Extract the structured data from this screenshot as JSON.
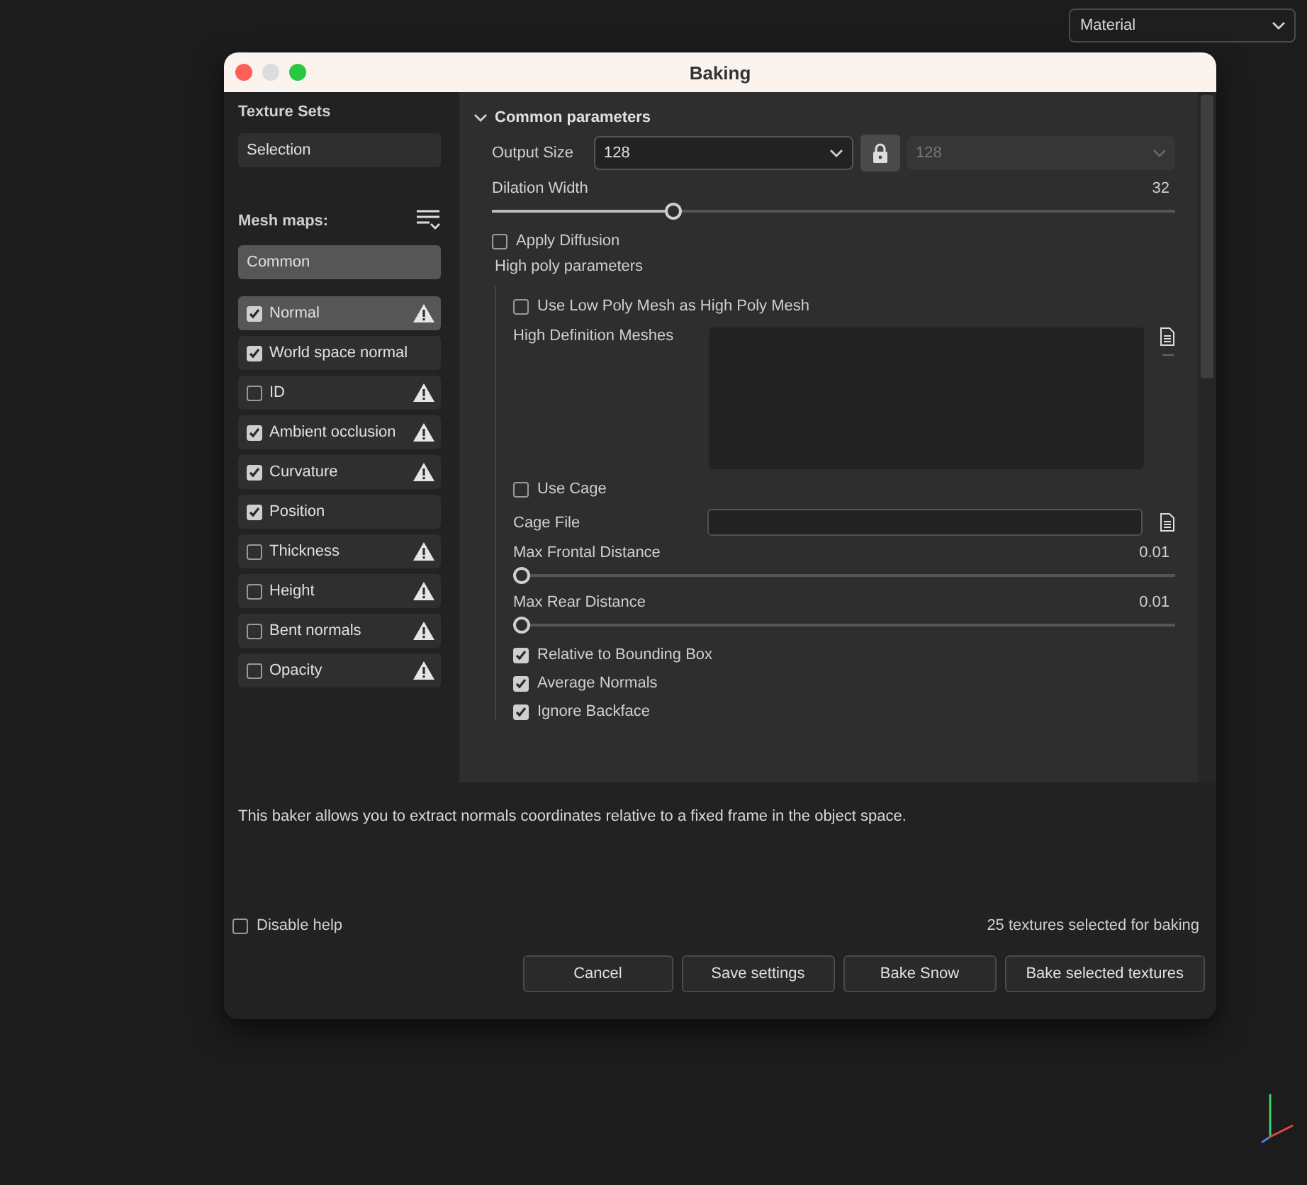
{
  "top_dropdown": {
    "value": "Material"
  },
  "window": {
    "title": "Baking"
  },
  "sidebar": {
    "texture_sets_title": "Texture Sets",
    "texture_sets": [
      {
        "label": "Selection",
        "selected": false
      }
    ],
    "mesh_maps_title": "Mesh maps:",
    "groups": [
      {
        "label": "Common",
        "selected": true
      }
    ],
    "maps": [
      {
        "label": "Normal",
        "checked": true,
        "warning": true,
        "selected": true
      },
      {
        "label": "World space normal",
        "checked": true,
        "warning": false,
        "selected": false
      },
      {
        "label": "ID",
        "checked": false,
        "warning": true,
        "selected": false
      },
      {
        "label": "Ambient occlusion",
        "checked": true,
        "warning": true,
        "selected": false
      },
      {
        "label": "Curvature",
        "checked": true,
        "warning": true,
        "selected": false
      },
      {
        "label": "Position",
        "checked": true,
        "warning": false,
        "selected": false
      },
      {
        "label": "Thickness",
        "checked": false,
        "warning": true,
        "selected": false
      },
      {
        "label": "Height",
        "checked": false,
        "warning": true,
        "selected": false
      },
      {
        "label": "Bent normals",
        "checked": false,
        "warning": true,
        "selected": false
      },
      {
        "label": "Opacity",
        "checked": false,
        "warning": true,
        "selected": false
      }
    ]
  },
  "section": {
    "title": "Common parameters",
    "expanded": true,
    "params": [
      {
        "kind": "select",
        "label": "Output Size",
        "value": "128",
        "locked": true,
        "linked_value": "128"
      },
      {
        "kind": "slider",
        "label": "Dilation Width",
        "reading": "32",
        "level": 0.26
      },
      {
        "kind": "checkbox",
        "label": "Apply Diffusion",
        "checked": false
      },
      {
        "kind": "heading",
        "label": "High poly parameters"
      }
    ],
    "high_poly": [
      {
        "kind": "checkbox",
        "label": "Use Low Poly Mesh as High Poly Mesh",
        "checked": false
      },
      {
        "kind": "list",
        "label": "High Definition Meshes"
      },
      {
        "kind": "checkbox",
        "label": "Use Cage",
        "checked": false
      },
      {
        "kind": "file",
        "label": "Cage File"
      },
      {
        "kind": "slider",
        "label": "Max Frontal Distance",
        "reading": "0.01",
        "level": 0
      },
      {
        "kind": "slider",
        "label": "Max Rear Distance",
        "reading": "0.01",
        "level": 0
      },
      {
        "kind": "checkbox",
        "label": "Relative to Bounding Box",
        "checked": true
      },
      {
        "kind": "checkbox",
        "label": "Average Normals",
        "checked": true
      },
      {
        "kind": "checkbox",
        "label": "Ignore Backface",
        "checked": true
      }
    ]
  },
  "help": {
    "text": "This baker allows you to extract normals coordinates relative to a fixed frame in the object space."
  },
  "disable_help": {
    "label": "Disable help",
    "checked": false
  },
  "status": "25 textures selected for baking",
  "buttons": [
    "Cancel",
    "Save settings",
    "Bake Snow",
    "Bake selected textures"
  ]
}
